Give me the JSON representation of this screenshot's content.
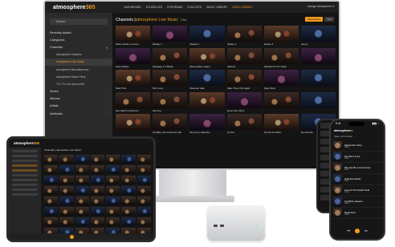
{
  "app": {
    "logo_main": "atmosphere",
    "logo_accent": "365",
    "accent_color": "#f39a1e"
  },
  "monitor": {
    "nav": [
      "DASHBOARD",
      "SCHEDULES",
      "PROGRAMS",
      "PLAYLISTS",
      "MUSIC LIBRARY",
      "VIDEO LIBRARY"
    ],
    "active_nav_index": 5,
    "user": "orange atmosphere ▾",
    "search_placeholder": "Search",
    "sidebar": [
      {
        "label": "Recently Added",
        "sub": false,
        "chev": ""
      },
      {
        "label": "Categories",
        "sub": false,
        "chev": "›"
      },
      {
        "label": "Channels",
        "sub": false,
        "chev": "▾"
      },
      {
        "label": "atmosphere Classics",
        "sub": true,
        "chev": ""
      },
      {
        "label": "atmosphere Live Music",
        "sub": true,
        "chev": "›",
        "selected": true
      },
      {
        "label": "atmosphere Miscellaneous",
        "sub": true,
        "chev": ""
      },
      {
        "label": "atmosphere Music Films",
        "sub": true,
        "chev": ""
      },
      {
        "label": "TLV TV Live Specs/Orb",
        "sub": true,
        "chev": ""
      },
      {
        "label": "Series",
        "sub": false,
        "chev": "›"
      },
      {
        "label": "Albums",
        "sub": false,
        "chev": "›"
      },
      {
        "label": "Artists",
        "sub": false,
        "chev": "›"
      },
      {
        "label": "Attributes",
        "sub": false,
        "chev": "›"
      }
    ],
    "title_prefix": "Channels | ",
    "title_accent": "atmosphere Live Music",
    "title_tag": "Filter",
    "sort_buttons": [
      "Show Filters",
      "Sort"
    ],
    "tiles": [
      "Mister Rocker Concert",
      "Medley 1",
      "Medley 2",
      "Medley 3",
      "Medley 4",
      "Honey",
      "Heavy Beast",
      "Message In A Bottle",
      "Metropolitan Insane",
      "Midwest",
      "Midnight At The Oasis",
      "",
      "Mind Trick",
      "Mo's Love",
      "Molecule Cafe",
      "Make Them Out Again",
      "Stays Slow",
      "",
      "Neo Sight Conference",
      "Morning",
      "",
      "Street Like Jazzy",
      "",
      "",
      "",
      "My Baby Just Cares For Me",
      "My Funny Valentine",
      "My Girl",
      "My Girl and Who",
      "My Favorite"
    ]
  },
  "tablet": {
    "header": "Channels | atmosphere Live Music"
  },
  "phone": {
    "time": "9:41",
    "signal": "▮▮▮ ◔",
    "logo_main": "atmosphere",
    "logo_accent": "tv",
    "section": "Video | All Content",
    "items": [
      {
        "title": "September Song",
        "sub": "Video"
      },
      {
        "title": "Into Me & Love",
        "sub": "Video"
      },
      {
        "title": "We Can Be A Good Guys",
        "sub": "Video"
      },
      {
        "title": "Hold Somebody",
        "sub": "Video"
      },
      {
        "title": "Love At The Studio Seal",
        "sub": "Video"
      },
      {
        "title": "Cry Baby Heaven",
        "sub": "Video"
      },
      {
        "title": "Fixed Idea",
        "sub": "Video"
      }
    ],
    "controls": [
      "⏮",
      "⏭"
    ]
  }
}
